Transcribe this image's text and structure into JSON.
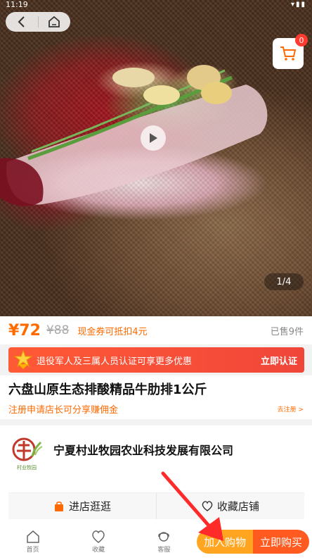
{
  "status_bar": {
    "time": "11:19"
  },
  "hero": {
    "page_indicator": "1/4",
    "cart_count": "0"
  },
  "price": {
    "current": "¥72",
    "original": "¥88",
    "coupon_note": "现金券可抵扣4元",
    "sold": "已售9件"
  },
  "promo": {
    "text": "退役军人及三属人员认证可享更多优惠",
    "cta": "立即认证"
  },
  "product": {
    "title": "六盘山原生态排酸精品牛肋排1公斤",
    "reg_note": "注册申请店长可分享赚佣金",
    "reg_link": "去注册 >"
  },
  "store": {
    "name": "宁夏村业牧园农业科技发展有限公司",
    "logo_text": "村业牧园",
    "visit_label": "进店逛逛",
    "favorite_label": "收藏店铺"
  },
  "bottom_bar": {
    "tabs": [
      {
        "label": "首页",
        "icon": "home-icon"
      },
      {
        "label": "收藏",
        "icon": "heart-icon"
      },
      {
        "label": "客服",
        "icon": "service-icon"
      }
    ],
    "add_to_cart": "加入购物",
    "buy_now": "立即购买"
  },
  "colors": {
    "accent": "#ff6a00",
    "cart_badge": "#ff3b30",
    "add_cart": "#ffa51f",
    "buy_now": "#ff5a1f",
    "promo": "#f0463a"
  }
}
